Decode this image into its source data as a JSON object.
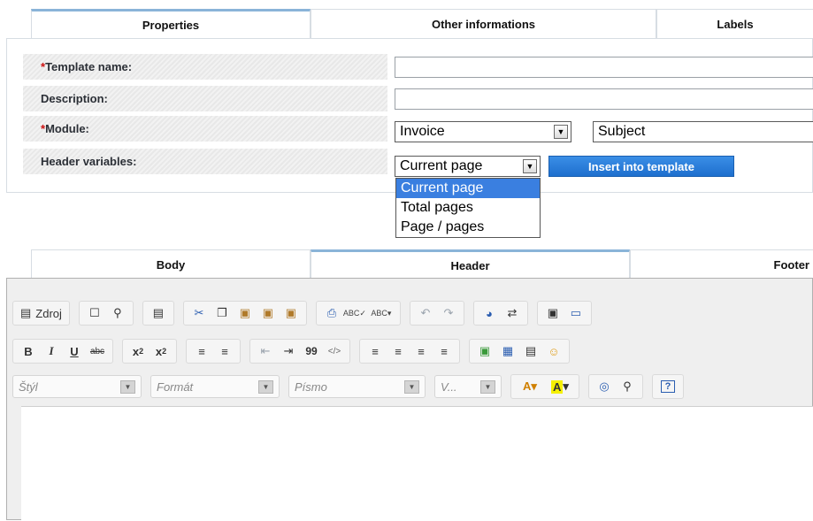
{
  "tabs": {
    "properties": "Properties",
    "other": "Other informations",
    "labels": "Labels"
  },
  "form": {
    "template_name": {
      "required": "*",
      "label": "Template name:",
      "value": ""
    },
    "description": {
      "label": "Description:",
      "value": ""
    },
    "module": {
      "required": "*",
      "label": "Module:",
      "value": "Invoice",
      "subject_value": "Subject"
    },
    "header_variables": {
      "label": "Header variables:",
      "value": "Current page",
      "insert_label": "Insert into template",
      "options": [
        "Current page",
        "Total pages",
        "Page / pages"
      ]
    }
  },
  "editor_tabs": {
    "body": "Body",
    "header": "Header",
    "footer": "Footer"
  },
  "toolbar": {
    "source_label": "Zdroj",
    "bold": "B",
    "italic": "I",
    "underline": "U",
    "strike": "abc",
    "subscript": "x",
    "sub2": "2",
    "superscript": "x",
    "sup2": "2",
    "quote": "99",
    "style_combo": "Štýl",
    "format_combo": "Formát",
    "font_combo": "Písmo",
    "size_combo": "V...",
    "help": "?"
  },
  "colors": {
    "accent": "#8ab4d8",
    "button_blue": "#2a7fd8",
    "required": "#cc1111"
  }
}
